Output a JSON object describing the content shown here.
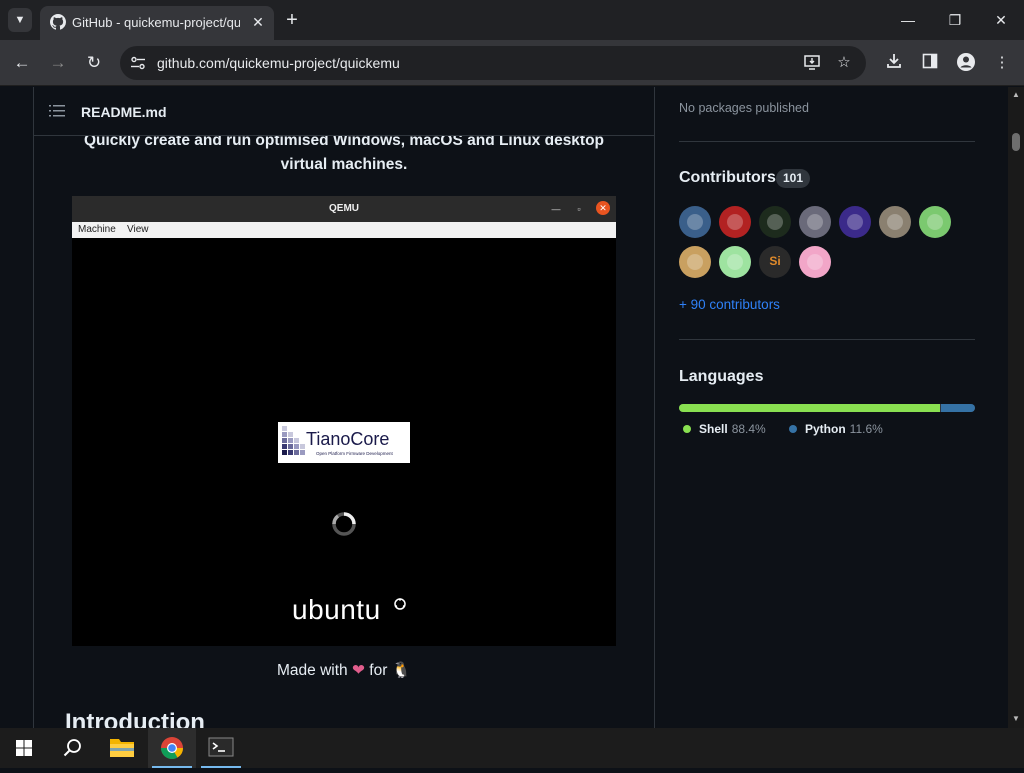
{
  "browser": {
    "tab": {
      "title": "GitHub - quickemu-project/quickemu",
      "favicon": "github-icon",
      "close": "✕"
    },
    "new_tab": "+",
    "window_controls": {
      "minimize": "—",
      "maximize": "❐",
      "close": "✕"
    },
    "url": "github.com/quickemu-project/quickemu",
    "nav": {
      "back": "←",
      "forward": "→",
      "reload": "↻"
    }
  },
  "readme": {
    "file_name": "README.md",
    "tagline": "Quickly create and run optimised Windows, macOS and Linux desktop virtual machines.",
    "qemu_window": {
      "title": "QEMU",
      "menu": [
        "Machine",
        "View"
      ],
      "boot_logo": {
        "title": "TianoCore",
        "subtitle": "Open Platform Firmware Development"
      },
      "os_brand": "ubuntu"
    },
    "made_with": {
      "prefix": "Made with",
      "heart": "❤",
      "for": "for",
      "penguin": "🐧"
    },
    "intro_heading": "Introduction"
  },
  "sidebar": {
    "packages_text": "No packages published",
    "contributors": {
      "title": "Contributors",
      "count": "101",
      "more_link": "+ 90 contributors",
      "avatars": [
        {
          "color": "#3a5f8a"
        },
        {
          "color": "#b22222"
        },
        {
          "color": "#1d2b1d"
        },
        {
          "color": "#6a6a7a"
        },
        {
          "color": "#3b2a8a"
        },
        {
          "color": "#8a8070"
        },
        {
          "color": "#7bc96f"
        },
        {
          "color": "#c9a060"
        },
        {
          "color": "#9ee3a0"
        },
        {
          "color": "#2a2a2a",
          "initials": "Si"
        },
        {
          "color": "#f2a6c8"
        }
      ]
    },
    "languages": {
      "title": "Languages",
      "items": [
        {
          "name": "Shell",
          "percent": "88.4%",
          "value": 88.4,
          "color": "#89e051"
        },
        {
          "name": "Python",
          "percent": "11.6%",
          "value": 11.6,
          "color": "#3572a5"
        }
      ]
    }
  },
  "taskbar": {
    "apps": [
      "start-icon",
      "search-icon",
      "file-explorer-icon",
      "chrome-icon",
      "terminal-icon"
    ]
  }
}
